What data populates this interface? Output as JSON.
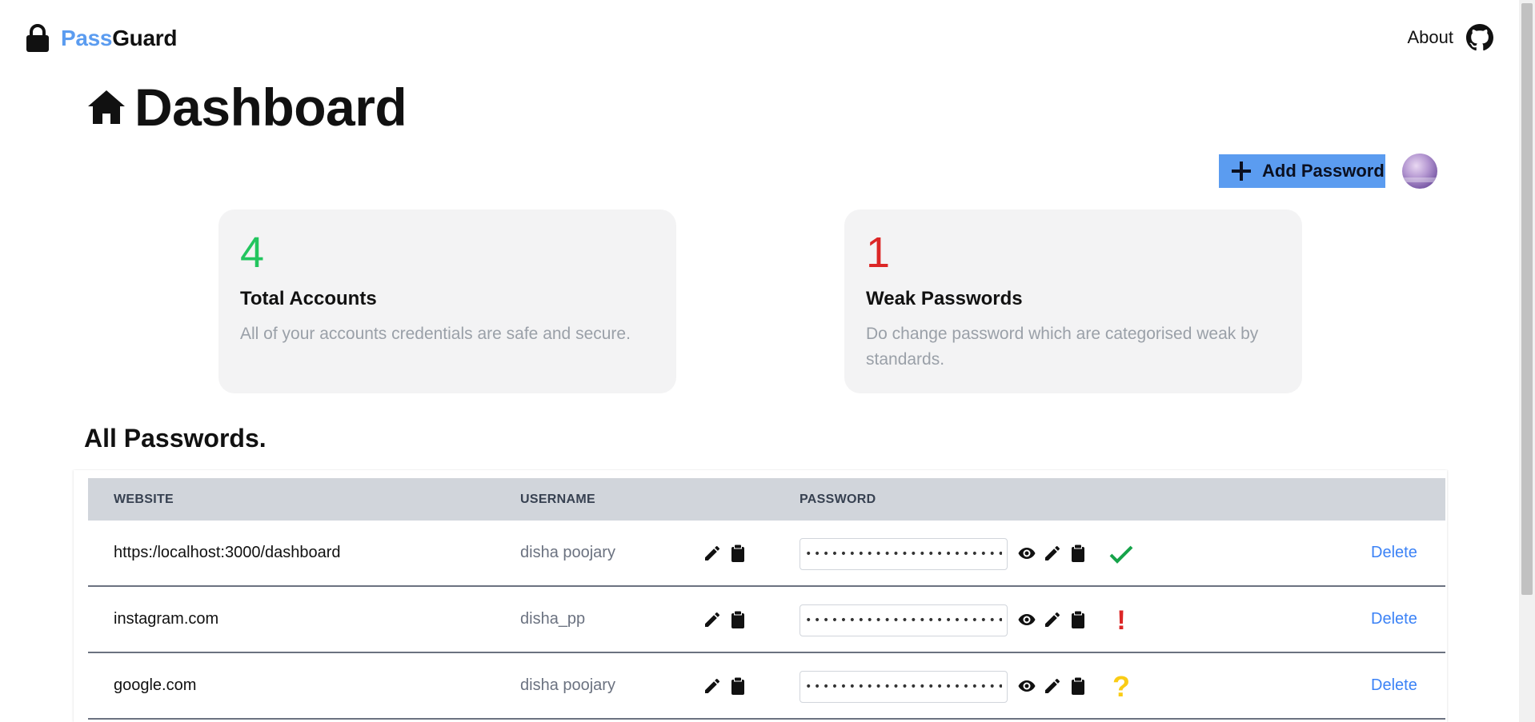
{
  "app": {
    "logo_pass": "Pass",
    "logo_guard": "Guard",
    "nav_about": "About",
    "accent_color": "#5b9cf0"
  },
  "page": {
    "title": "Dashboard",
    "add_button_label": "Add Password"
  },
  "cards": [
    {
      "number": "4",
      "number_color": "#22c55e",
      "title": "Total Accounts",
      "description": "All of your accounts credentials are safe and secure."
    },
    {
      "number": "1",
      "number_color": "#dc2626",
      "title": "Weak Passwords",
      "description": "Do change password which are categorised weak by standards."
    }
  ],
  "passwords": {
    "section_title": "All Passwords.",
    "columns": {
      "website": "WEBSITE",
      "username": "USERNAME",
      "password": "PASSWORD"
    },
    "rows": [
      {
        "website": "https:/localhost:3000/dashboard",
        "username": "disha poojary",
        "password_masked": "••••••••••••••••••••••••",
        "strength": "strong",
        "strength_icon": "check-icon",
        "action": "Delete"
      },
      {
        "website": "instagram.com",
        "username": "disha_pp",
        "password_masked": "••••••••••••••••••••••••",
        "strength": "weak",
        "strength_icon": "exclamation-icon",
        "strength_text": "!",
        "action": "Delete"
      },
      {
        "website": "google.com",
        "username": "disha poojary",
        "password_masked": "••••••••••••••••••••••••",
        "strength": "unknown",
        "strength_icon": "question-icon",
        "strength_text": "?",
        "action": "Delete"
      }
    ]
  }
}
